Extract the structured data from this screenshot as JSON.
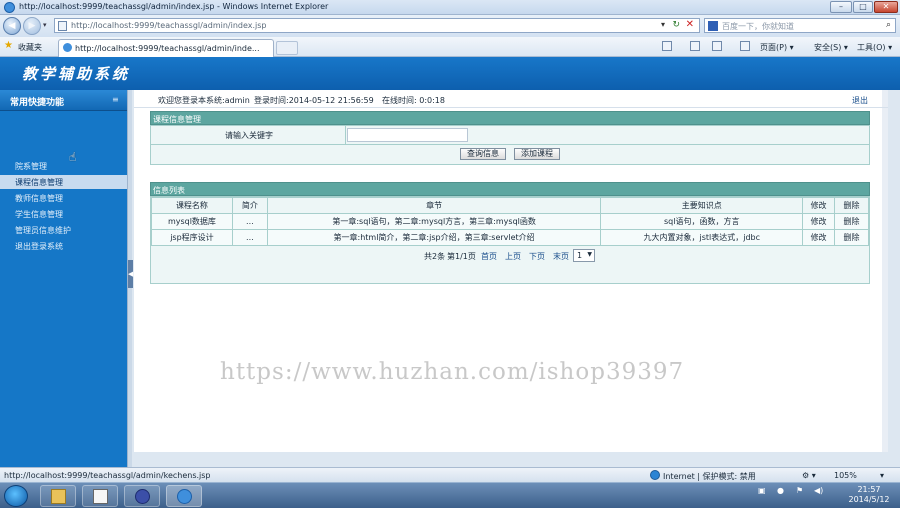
{
  "window": {
    "title": "http://localhost:9999/teachassgl/admin/index.jsp - Windows Internet Explorer",
    "minimize": "–",
    "maximize": "□",
    "close": "✕"
  },
  "addressbar": {
    "url": "http://localhost:9999/teachassgl/admin/index.jsp",
    "search_placeholder": "百度一下，你就知道"
  },
  "favbar": {
    "favorites_label": "收藏夹",
    "tab_label": "http://localhost:9999/teachassgl/admin/inde...",
    "page_menu": "页面(P) ▾",
    "safety_menu": "安全(S) ▾",
    "tools_menu": "工具(O) ▾"
  },
  "banner": {
    "brand": "教学辅助系统"
  },
  "sidebar": {
    "title": "常用快捷功能",
    "items": [
      {
        "label": "院系管理"
      },
      {
        "label": "课程信息管理"
      },
      {
        "label": "教师信息管理"
      },
      {
        "label": "学生信息管理"
      },
      {
        "label": "管理员信息维护"
      },
      {
        "label": "退出登录系统"
      }
    ]
  },
  "topinfo": {
    "welcome": "欢迎您登录本系统:admin",
    "login_time": "登录时间:2014-05-12 21:56:59",
    "online_time": "在线时间: 0:0:18",
    "logout": "退出"
  },
  "course_manage": {
    "title": "课程信息管理",
    "keyword_label": "请输入关键字",
    "keyword_value": "",
    "query_button": "查询信息",
    "add_button": "添加课程"
  },
  "course_list": {
    "title": "信息列表",
    "columns": [
      "课程名称",
      "简介",
      "章节",
      "主要知识点",
      "修改",
      "删除"
    ],
    "rows": [
      [
        "mysql数据库",
        "...",
        "第一章:sql语句，第二章:mysql方言，第三章:mysql函数",
        "sql语句，函数，方言",
        "修改",
        "删除"
      ],
      [
        "jsp程序设计",
        "...",
        "第一章:html简介，第二章:jsp介绍，第三章:servlet介绍",
        "九大内置对象，jstl表达式，jdbc",
        "修改",
        "删除"
      ]
    ],
    "pager": {
      "total": "共2条",
      "page_of": "第1/1页",
      "first": "首页",
      "prev": "上页",
      "next": "下页",
      "last": "末页",
      "select_value": "1"
    }
  },
  "watermark": "https://www.huzhan.com/ishop39397",
  "statusbar": {
    "url": "http://localhost:9999/teachassgl/admin/kechens.jsp",
    "zone": "Internet | 保护模式: 禁用",
    "zoom": "105%"
  },
  "taskbar": {
    "time": "21:57",
    "date": "2014/5/12"
  }
}
